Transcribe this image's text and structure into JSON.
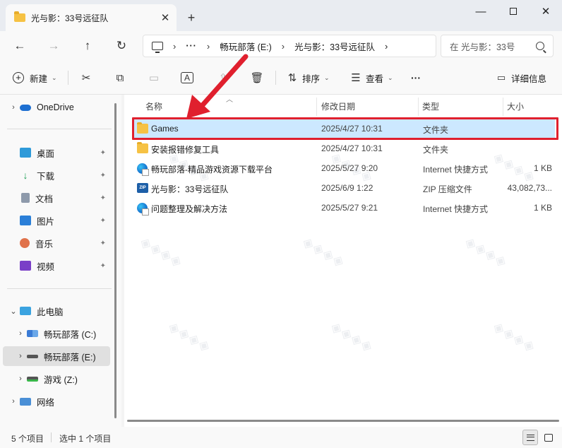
{
  "window": {
    "tab_title": "光与影：33号远征队",
    "new_tab": "+",
    "minimize": "—",
    "close_tab": "✕",
    "close_window": "✕"
  },
  "nav": {
    "back": "←",
    "forward": "→",
    "up": "↑",
    "refresh": "↻"
  },
  "breadcrumb": {
    "more": "···",
    "items": [
      "畅玩部落 (E:)",
      "光与影：33号远征队"
    ],
    "expand": "›"
  },
  "search": {
    "placeholder": "在 光与影：33号"
  },
  "toolbar": {
    "new_label": "新建",
    "sort_label": "排序",
    "view_label": "查看",
    "more": "···",
    "details_label": "详细信息"
  },
  "sidebar": {
    "onedrive": "OneDrive",
    "quick_access": [
      "桌面",
      "下载",
      "文档",
      "图片",
      "音乐",
      "视频"
    ],
    "this_pc": "此电脑",
    "drives": [
      "畅玩部落 (C:)",
      "畅玩部落 (E:)",
      "游戏 (Z:)"
    ],
    "network": "网络"
  },
  "columns": {
    "name": "名称",
    "date": "修改日期",
    "type": "类型",
    "size": "大小"
  },
  "files": [
    {
      "name": "Games",
      "date": "2025/4/27 10:31",
      "type": "文件夹",
      "size": "",
      "icon": "folder-icon"
    },
    {
      "name": "安装报错修复工具",
      "date": "2025/4/27 10:31",
      "type": "文件夹",
      "size": "",
      "icon": "folder-icon"
    },
    {
      "name": "畅玩部落-精品游戏资源下载平台",
      "date": "2025/5/27 9:20",
      "type": "Internet 快捷方式",
      "size": "1 KB",
      "icon": "internet-shortcut-icon"
    },
    {
      "name": "光与影：33号远征队",
      "date": "2025/6/9 1:22",
      "type": "ZIP 压缩文件",
      "size": "43,082,73...",
      "icon": "zip-file-icon"
    },
    {
      "name": "问题整理及解决方法",
      "date": "2025/5/27 9:21",
      "type": "Internet 快捷方式",
      "size": "1 KB",
      "icon": "internet-shortcut-icon"
    }
  ],
  "status": {
    "item_count": "5 个项目",
    "selected": "选中 1 个项目"
  },
  "colors": {
    "selection": "#cce8ff",
    "highlight_border": "#e0202e",
    "annotation_arrow": "#e0202e"
  }
}
